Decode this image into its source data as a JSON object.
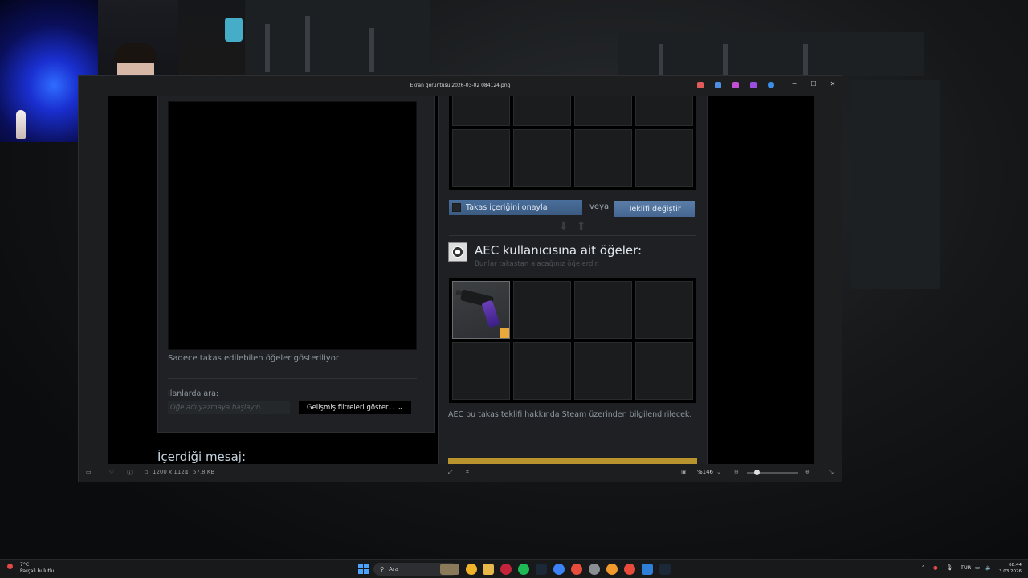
{
  "viewer": {
    "title": "Ekran görüntüsü 2026-03-02 084124.png",
    "minimize": "─",
    "maximize": "☐",
    "close": "✕",
    "status": {
      "dimensions": "1200 x 1121",
      "filesize": "57,8 KB",
      "zoom": "%146",
      "zoom_level_fraction": 0.2
    }
  },
  "steam_left": {
    "tradable_note": "Sadece takas edilebilen öğeler gösteriliyor",
    "search_label": "İlanlarda ara:",
    "search_placeholder": "Öğe adı yazmaya başlayın...",
    "filter_button": "Gelişmiş filtreleri göster...",
    "message_heading": "İçerdiği mesaj:"
  },
  "steam_right": {
    "confirm_label": "Takas içeriğini onayla",
    "or_label": "veya",
    "change_offer": "Teklifi değiştir",
    "their_title": "AEC kullanıcısına ait öğeler:",
    "their_subtitle": "Bunlar takastan alacağınız öğelerdir.",
    "notify_text": "AEC bu takas teklifi hakkında Steam üzerinden bilgilendirilecek.",
    "received_items": [
      {
        "name": "revolver-item",
        "filled": true
      },
      {
        "filled": false
      },
      {
        "filled": false
      },
      {
        "filled": false
      },
      {
        "filled": false
      },
      {
        "filled": false
      },
      {
        "filled": false
      },
      {
        "filled": false
      }
    ]
  },
  "taskbar": {
    "weather_temp": "7°C",
    "weather_desc": "Parçalı bulutlu",
    "search": "Ara",
    "language": "TUR",
    "time": "08:44",
    "date": "3.03.2026"
  },
  "colors": {
    "steam_button": "#4a6f9c",
    "steam_accent_gold": "#b8932e",
    "item_grip": "#6b3fb8"
  }
}
